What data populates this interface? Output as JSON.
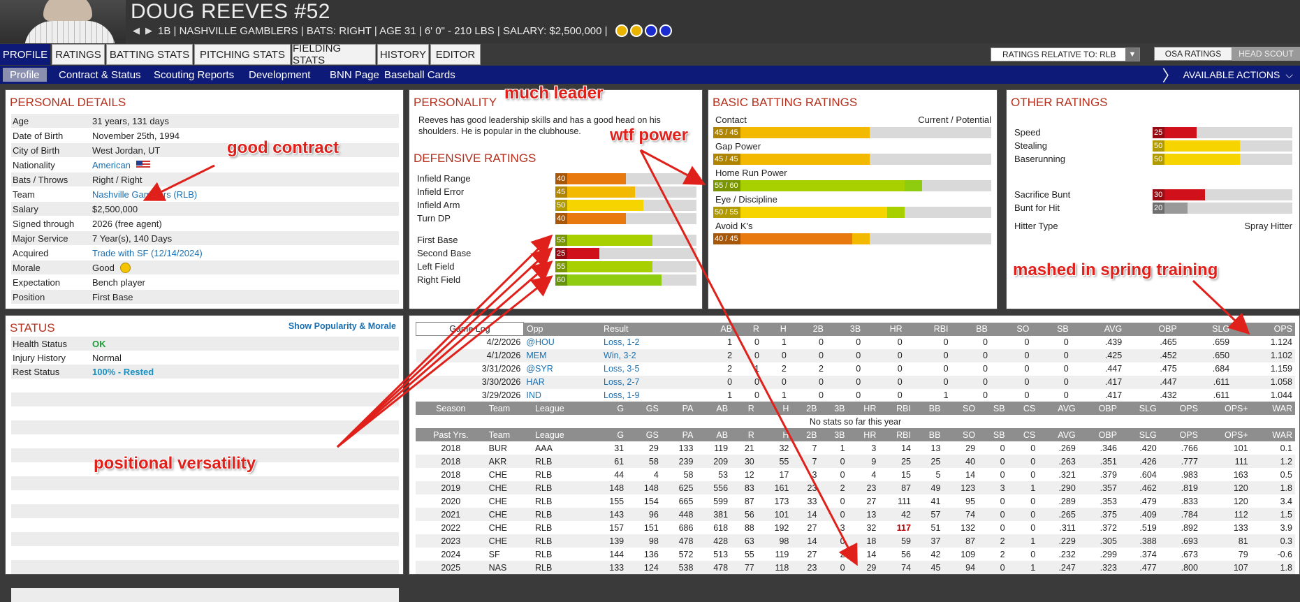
{
  "header": {
    "player_name": "DOUG REEVES  #52",
    "info": "1B | NASHVILLE GAMBLERS  |  BATS: RIGHT  |  AGE 31  |  6' 0\" - 210 LBS  |  SALARY: $2,500,000  |",
    "badges": [
      {
        "icon": "baseball-award-icon",
        "color": "#e8b400"
      },
      {
        "icon": "glove-award-icon",
        "color": "#e8b400"
      },
      {
        "icon": "star-award-icon",
        "color": "#1a2bd0"
      },
      {
        "icon": "star-award-icon",
        "color": "#1a2bd0"
      }
    ]
  },
  "tabs": [
    "PROFILE",
    "RATINGS",
    "BATTING STATS",
    "PITCHING STATS",
    "FIELDING STATS",
    "HISTORY",
    "EDITOR"
  ],
  "controls": {
    "relative_to": "RATINGS RELATIVE TO: RLB",
    "osa": "OSA RATINGS",
    "head_scout": "HEAD SCOUT",
    "available_actions": "AVAILABLE ACTIONS"
  },
  "subnav": [
    "Profile",
    "Contract & Status",
    "Scouting Reports",
    "Development",
    "BNN Page",
    "Baseball Cards"
  ],
  "personal": {
    "title": "PERSONAL DETAILS",
    "rows": [
      {
        "k": "Age",
        "v": "31 years, 131 days"
      },
      {
        "k": "Date of Birth",
        "v": "November 25th, 1994"
      },
      {
        "k": "City of Birth",
        "v": "West Jordan, UT"
      },
      {
        "k": "Nationality",
        "v": "American"
      },
      {
        "k": "Bats / Throws",
        "v": "Right / Right"
      },
      {
        "k": "Team",
        "v": "Nashville Gamblers (RLB)"
      },
      {
        "k": "Salary",
        "v": "$2,500,000"
      },
      {
        "k": "Signed through",
        "v": "2026 (free agent)"
      },
      {
        "k": "Major Service",
        "v": "7 Year(s), 140 Days"
      },
      {
        "k": "Acquired",
        "v": "Trade with SF (12/14/2024)"
      },
      {
        "k": "Morale",
        "v": "Good"
      },
      {
        "k": "Expectation",
        "v": "Bench player"
      },
      {
        "k": "Position",
        "v": "First Base"
      }
    ]
  },
  "status": {
    "title": "STATUS",
    "link": "Show Popularity & Morale",
    "rows": [
      {
        "k": "Health Status",
        "v": "OK"
      },
      {
        "k": "Injury History",
        "v": "Normal"
      },
      {
        "k": "Rest Status",
        "v": "100% - Rested"
      }
    ]
  },
  "personality": {
    "title": "PERSONALITY",
    "text": "Reeves has good leadership skills and has a good head on his shoulders. He is popular in the clubhouse."
  },
  "defensive": {
    "title": "DEFENSIVE RATINGS",
    "ratings": [
      {
        "label": "Infield Range",
        "value": 40,
        "color": "#e8790e"
      },
      {
        "label": "Infield Error",
        "value": 45,
        "color": "#f3b800"
      },
      {
        "label": "Infield Arm",
        "value": 50,
        "color": "#f5d400"
      },
      {
        "label": "Turn DP",
        "value": 40,
        "color": "#e8790e"
      },
      {
        "label": "First Base",
        "value": 55,
        "color": "#a8d000"
      },
      {
        "label": "Second Base",
        "value": 25,
        "color": "#d0101a"
      },
      {
        "label": "Left Field",
        "value": 55,
        "color": "#a8d000"
      },
      {
        "label": "Right Field",
        "value": 60,
        "color": "#8fcc10"
      }
    ]
  },
  "batting": {
    "title": "BASIC BATTING RATINGS",
    "header": "Current / Potential",
    "ratings": [
      {
        "label": "Contact",
        "current": 45,
        "potential": 45,
        "text": "45 / 45",
        "color": "#f3b800",
        "pcolor": "#f3b800"
      },
      {
        "label": "Gap Power",
        "current": 45,
        "potential": 45,
        "text": "45 / 45",
        "color": "#f3b800",
        "pcolor": "#f3b800"
      },
      {
        "label": "Home Run Power",
        "current": 55,
        "potential": 60,
        "text": "55 / 60",
        "color": "#a8d000",
        "pcolor": "#8fcc10"
      },
      {
        "label": "Eye / Discipline",
        "current": 50,
        "potential": 55,
        "text": "50 / 55",
        "color": "#f5d400",
        "pcolor": "#a8d000"
      },
      {
        "label": "Avoid K's",
        "current": 40,
        "potential": 45,
        "text": "40 / 45",
        "color": "#e8790e",
        "pcolor": "#f3b800"
      }
    ]
  },
  "other": {
    "title": "OTHER RATINGS",
    "ratings": [
      {
        "label": "Speed",
        "value": 25,
        "color": "#d0101a"
      },
      {
        "label": "Stealing",
        "value": 50,
        "color": "#f5d400"
      },
      {
        "label": "Baserunning",
        "value": 50,
        "color": "#f5d400"
      },
      {
        "label": "Sacrifice Bunt",
        "value": 30,
        "color": "#d0101a"
      },
      {
        "label": "Bunt for Hit",
        "value": 20,
        "color": "#999999"
      }
    ],
    "hitter_type_label": "Hitter Type",
    "hitter_type": "Spray Hitter"
  },
  "game_log": {
    "headers": [
      "Game Log",
      "Opp",
      "Result",
      "AB",
      "R",
      "H",
      "2B",
      "3B",
      "HR",
      "RBI",
      "BB",
      "SO",
      "SB",
      "AVG",
      "OBP",
      "SLG",
      "OPS"
    ],
    "rows": [
      [
        "4/2/2026",
        "@HOU",
        "Loss, 1-2",
        "1",
        "0",
        "1",
        "0",
        "0",
        "0",
        "0",
        "0",
        "0",
        "0",
        ".439",
        ".465",
        ".659",
        "1.124"
      ],
      [
        "4/1/2026",
        "MEM",
        "Win, 3-2",
        "2",
        "0",
        "0",
        "0",
        "0",
        "0",
        "0",
        "0",
        "0",
        "0",
        ".425",
        ".452",
        ".650",
        "1.102"
      ],
      [
        "3/31/2026",
        "@SYR",
        "Loss, 3-5",
        "2",
        "1",
        "2",
        "2",
        "0",
        "0",
        "0",
        "0",
        "0",
        "0",
        ".447",
        ".475",
        ".684",
        "1.159"
      ],
      [
        "3/30/2026",
        "HAR",
        "Loss, 2-7",
        "0",
        "0",
        "0",
        "0",
        "0",
        "0",
        "0",
        "0",
        "0",
        "0",
        ".417",
        ".447",
        ".611",
        "1.058"
      ],
      [
        "3/29/2026",
        "IND",
        "Loss, 1-9",
        "1",
        "0",
        "1",
        "0",
        "0",
        "0",
        "1",
        "0",
        "0",
        "0",
        ".417",
        ".432",
        ".611",
        "1.044"
      ]
    ]
  },
  "season": {
    "headers": [
      "Season",
      "Team",
      "League",
      "G",
      "GS",
      "PA",
      "AB",
      "R",
      "H",
      "2B",
      "3B",
      "HR",
      "RBI",
      "BB",
      "SO",
      "SB",
      "CS",
      "AVG",
      "OBP",
      "SLG",
      "OPS",
      "OPS+",
      "WAR"
    ],
    "empty": "No stats so far this year"
  },
  "past": {
    "headers": [
      "Past Yrs.",
      "Team",
      "League",
      "G",
      "GS",
      "PA",
      "AB",
      "R",
      "H",
      "2B",
      "3B",
      "HR",
      "RBI",
      "BB",
      "SO",
      "SB",
      "CS",
      "AVG",
      "OBP",
      "SLG",
      "OPS",
      "OPS+",
      "WAR"
    ],
    "rows": [
      [
        "2018",
        "BUR",
        "AAA",
        "31",
        "29",
        "133",
        "119",
        "21",
        "32",
        "7",
        "1",
        "3",
        "14",
        "13",
        "29",
        "0",
        "0",
        ".269",
        ".346",
        ".420",
        ".766",
        "101",
        "0.1"
      ],
      [
        "2018",
        "AKR",
        "RLB",
        "61",
        "58",
        "239",
        "209",
        "30",
        "55",
        "7",
        "0",
        "9",
        "25",
        "25",
        "40",
        "0",
        "0",
        ".263",
        ".351",
        ".426",
        ".777",
        "111",
        "1.2"
      ],
      [
        "2018",
        "CHE",
        "RLB",
        "44",
        "4",
        "58",
        "53",
        "12",
        "17",
        "3",
        "0",
        "4",
        "15",
        "5",
        "14",
        "0",
        "0",
        ".321",
        ".379",
        ".604",
        ".983",
        "163",
        "0.5"
      ],
      [
        "2019",
        "CHE",
        "RLB",
        "148",
        "148",
        "625",
        "556",
        "83",
        "161",
        "23",
        "2",
        "23",
        "87",
        "49",
        "123",
        "3",
        "1",
        ".290",
        ".357",
        ".462",
        ".819",
        "120",
        "1.8"
      ],
      [
        "2020",
        "CHE",
        "RLB",
        "155",
        "154",
        "665",
        "599",
        "87",
        "173",
        "33",
        "0",
        "27",
        "111",
        "41",
        "95",
        "0",
        "0",
        ".289",
        ".353",
        ".479",
        ".833",
        "120",
        "3.4"
      ],
      [
        "2021",
        "CHE",
        "RLB",
        "143",
        "96",
        "448",
        "381",
        "56",
        "101",
        "14",
        "0",
        "13",
        "42",
        "57",
        "74",
        "0",
        "0",
        ".265",
        ".375",
        ".409",
        ".784",
        "112",
        "1.5"
      ],
      [
        "2022",
        "CHE",
        "RLB",
        "157",
        "151",
        "686",
        "618",
        "88",
        "192",
        "27",
        "3",
        "32",
        "117",
        "51",
        "132",
        "0",
        "0",
        ".311",
        ".372",
        ".519",
        ".892",
        "133",
        "3.9"
      ],
      [
        "2023",
        "CHE",
        "RLB",
        "139",
        "98",
        "478",
        "428",
        "63",
        "98",
        "14",
        "0",
        "18",
        "59",
        "37",
        "87",
        "2",
        "1",
        ".229",
        ".305",
        ".388",
        ".693",
        "81",
        "0.3"
      ],
      [
        "2024",
        "SF",
        "RLB",
        "144",
        "136",
        "572",
        "513",
        "55",
        "119",
        "27",
        "2",
        "14",
        "56",
        "42",
        "109",
        "2",
        "0",
        ".232",
        ".299",
        ".374",
        ".673",
        "79",
        "-0.6"
      ],
      [
        "2025",
        "NAS",
        "RLB",
        "133",
        "124",
        "538",
        "478",
        "77",
        "118",
        "23",
        "0",
        "29",
        "74",
        "45",
        "94",
        "0",
        "1",
        ".247",
        ".323",
        ".477",
        ".800",
        "107",
        "1.8"
      ]
    ]
  },
  "annotations": {
    "much_leader": "much leader",
    "good_contract": "good contract",
    "wtf_power": "wtf power",
    "mashed": "mashed in spring training",
    "positional": "positional versatility"
  }
}
